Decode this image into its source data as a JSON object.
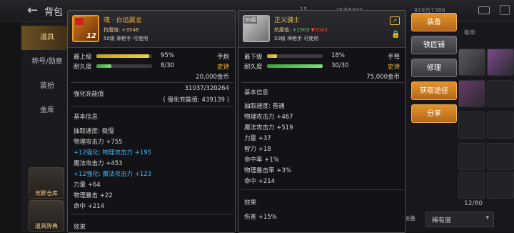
{
  "topbar": {
    "title": "背包",
    "num1": "15",
    "num2": "25万5591",
    "num3": "919万7386"
  },
  "nav": [
    "道具",
    "称号/勋章",
    "装扮",
    "金库"
  ],
  "quick": [
    "宠默仓库",
    "道具辞典"
  ],
  "panel1": {
    "name": "魂 · 白焰翼龙",
    "enhance": "抗魔值: +3548",
    "req": "50级 神枪手 可使用",
    "level_label": "最上级",
    "level_value": "95%",
    "level_fill": 0.95,
    "weapon_type": "手炮",
    "dur_label": "耐久度",
    "dur_value": "8/30",
    "dur_fill": 0.27,
    "rarity": "史诗",
    "price": "20,000金币",
    "enh_label": "强化充能值",
    "enh_value": "31037/320264",
    "enh_sub": "( 强化充能值: 439139 )",
    "basic_title": "基本信息",
    "stats": [
      "抽取速度: 极慢",
      "物理攻击力 +755",
      "+12强化: 物理攻击力 +195",
      "魔法攻击力 +453",
      "+12强化: 魔法攻击力 +123",
      "力量 +64",
      "物理暴击 +22",
      "命中 +214"
    ],
    "effect_title": "效果",
    "icon_badge": "12"
  },
  "panel2": {
    "name": "正义骑士",
    "enhance_prefix": "抗魔值:",
    "enhance_gain": "+1503",
    "enhance_loss": "▼2045",
    "req": "50级 神枪手 可使用",
    "level_label": "最下级",
    "level_value": "18%",
    "level_fill": 0.18,
    "weapon_type": "手弩",
    "dur_label": "耐久度",
    "dur_value": "30/30",
    "dur_fill": 1.0,
    "rarity": "史诗",
    "price": "75,000金币",
    "basic_title": "基本信息",
    "stats": [
      "抽取速度: 普通",
      "物理攻击力 +467",
      "魔法攻击力 +519",
      "力量 +37",
      "智力 +18",
      "命中率 +1%",
      "物理暴击率 +3%",
      "命中 +214"
    ],
    "effect_title": "效果",
    "effect_line": "伤害 +15%",
    "level_badge": "50级"
  },
  "actions": [
    "装备",
    "铁匠铺",
    "修理",
    "获取途径",
    "分享"
  ],
  "inventory": {
    "count": "12/80",
    "sort": "稀有度",
    "equip_tab": "装备",
    "tab_label": "徽章"
  },
  "colors": {
    "accent": "#e2942a",
    "epic": "#f0a43a",
    "enhance_blue": "#3fb7ff"
  }
}
